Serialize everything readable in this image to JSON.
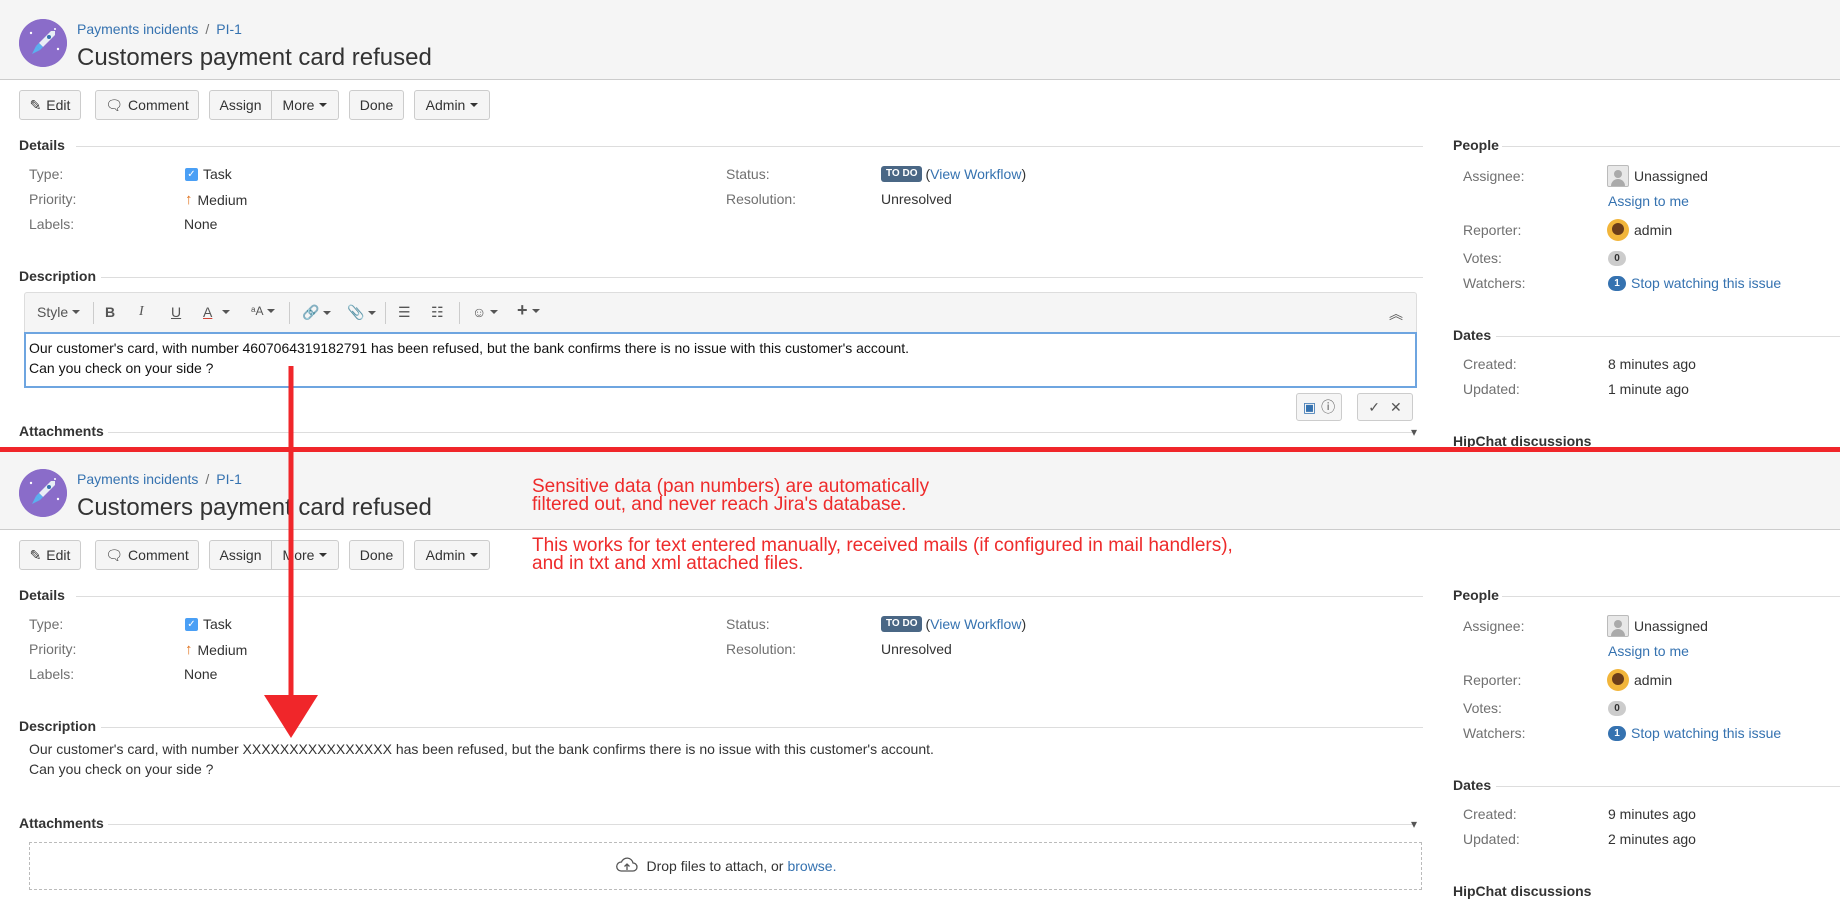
{
  "top": {
    "breadcrumb": {
      "project": "Payments incidents",
      "sep": "/",
      "key": "PI-1"
    },
    "title": "Customers payment card refused",
    "toolbar": {
      "edit": "Edit",
      "comment": "Comment",
      "assign": "Assign",
      "more": "More",
      "done": "Done",
      "admin": "Admin"
    },
    "details": {
      "heading": "Details",
      "type_label": "Type:",
      "type_value": "Task",
      "priority_label": "Priority:",
      "priority_value": "Medium",
      "labels_label": "Labels:",
      "labels_value": "None",
      "status_label": "Status:",
      "status_value": "TO DO",
      "status_open": "(",
      "workflow_link": "View Workflow",
      "status_close": ")",
      "resolution_label": "Resolution:",
      "resolution_value": "Unresolved"
    },
    "people": {
      "heading": "People",
      "assignee_label": "Assignee:",
      "assignee_value": "Unassigned",
      "assign_to_me": "Assign to me",
      "reporter_label": "Reporter:",
      "reporter_value": "admin",
      "votes_label": "Votes:",
      "votes_value": "0",
      "watchers_label": "Watchers:",
      "watchers_count": "1",
      "watchers_link": "Stop watching this issue"
    },
    "dates": {
      "heading": "Dates",
      "created_label": "Created:",
      "created_value": "8 minutes ago",
      "updated_label": "Updated:",
      "updated_value": "1 minute ago"
    },
    "description": {
      "heading": "Description",
      "editor": {
        "style": "Style",
        "bold": "B",
        "italic": "I",
        "underline": "U",
        "color": "A",
        "text_size": "ᵃA"
      },
      "line1": "Our customer's card, with number 4607064319182791 has been refused, but the bank confirms there is no issue with this customer's account.",
      "line2": "Can you check on your side ?"
    },
    "attachments_heading": "Attachments",
    "hipchat_heading": "HipChat discussions"
  },
  "bottom": {
    "breadcrumb": {
      "project": "Payments incidents",
      "sep": "/",
      "key": "PI-1"
    },
    "title": "Customers payment card refused",
    "toolbar": {
      "edit": "Edit",
      "comment": "Comment",
      "assign": "Assign",
      "more": "More",
      "done": "Done",
      "admin": "Admin"
    },
    "details": {
      "heading": "Details",
      "type_label": "Type:",
      "type_value": "Task",
      "priority_label": "Priority:",
      "priority_value": "Medium",
      "labels_label": "Labels:",
      "labels_value": "None",
      "status_label": "Status:",
      "status_value": "TO DO",
      "status_open": "(",
      "workflow_link": "View Workflow",
      "status_close": ")",
      "resolution_label": "Resolution:",
      "resolution_value": "Unresolved"
    },
    "people": {
      "heading": "People",
      "assignee_label": "Assignee:",
      "assignee_value": "Unassigned",
      "assign_to_me": "Assign to me",
      "reporter_label": "Reporter:",
      "reporter_value": "admin",
      "votes_label": "Votes:",
      "votes_value": "0",
      "watchers_label": "Watchers:",
      "watchers_count": "1",
      "watchers_link": "Stop watching this issue"
    },
    "dates": {
      "heading": "Dates",
      "created_label": "Created:",
      "created_value": "9 minutes ago",
      "updated_label": "Updated:",
      "updated_value": "2 minutes ago"
    },
    "description": {
      "heading": "Description",
      "line1": "Our customer's card, with number XXXXXXXXXXXXXXXX has been refused, but the bank confirms there is no issue with this customer's account.",
      "line2": "Can you check on your side ?"
    },
    "attachments_heading": "Attachments",
    "dropzone": {
      "text": "Drop files to attach, or",
      "browse": "browse."
    },
    "hipchat_heading": "HipChat discussions"
  },
  "annotation": {
    "line1": "Sensitive data (pan numbers) are automatically",
    "line2": "filtered out, and never reach Jira's database.",
    "line3": "This works for text entered manually, received mails (if configured in mail handlers),",
    "line4": "and in txt and xml attached files."
  },
  "colors": {
    "accent": "#3572b0",
    "annotation": "#ee2b2b",
    "status_lozenge": "#4a6785"
  }
}
